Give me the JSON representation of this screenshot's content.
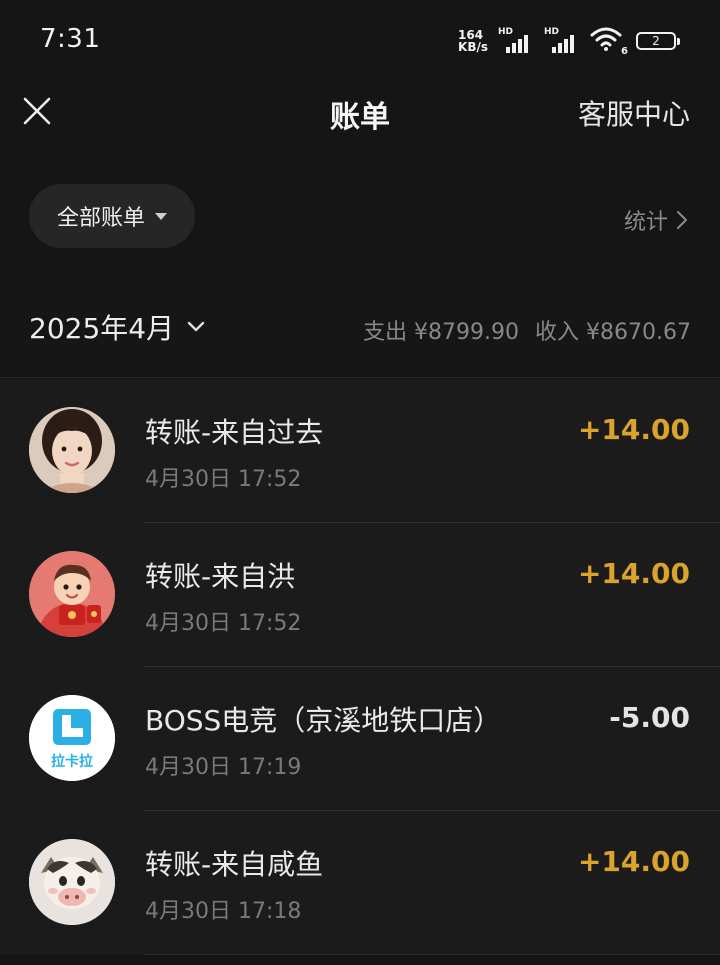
{
  "status_bar": {
    "time": "7:31",
    "speed_value": "164",
    "speed_unit": "KB/s",
    "hd1": "HD",
    "hd2": "HD",
    "wifi_sub": "6",
    "battery": "2"
  },
  "header": {
    "title": "账单",
    "service_label": "客服中心",
    "close_icon": "close-icon"
  },
  "filter": {
    "label": "全部账单",
    "stats_label": "统计"
  },
  "month": {
    "label": "2025年4月",
    "expense": "支出 ¥8799.90",
    "income": "收入 ¥8670.67"
  },
  "transactions": [
    {
      "title": "转账-来自过去",
      "time": "4月30日 17:52",
      "amount": "+14.00",
      "type": "income",
      "avatar": "girl-portrait"
    },
    {
      "title": "转账-来自洪",
      "time": "4月30日 17:52",
      "amount": "+14.00",
      "type": "income",
      "avatar": "cartoon-red-envelope"
    },
    {
      "title": "BOSS电竞（京溪地铁口店）",
      "time": "4月30日 17:19",
      "amount": "-5.00",
      "type": "expense",
      "avatar": "lakala-logo",
      "avatar_text": "拉卡拉"
    },
    {
      "title": "转账-来自咸鱼",
      "time": "4月30日 17:18",
      "amount": "+14.00",
      "type": "income",
      "avatar": "cartoon-cow"
    }
  ],
  "colors": {
    "income": "#d9a32c",
    "expense": "#e4e4e4",
    "background": "#151515",
    "lakala_blue": "#2ab0e4"
  }
}
